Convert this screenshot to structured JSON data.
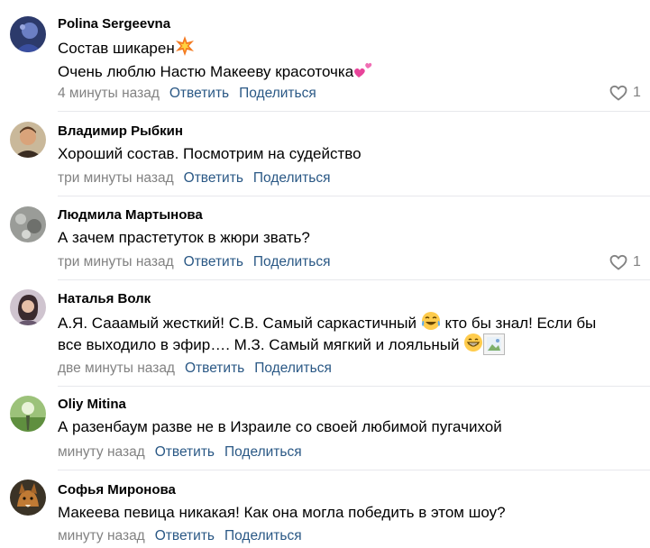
{
  "comments": [
    {
      "author": "Polina Sergeevna",
      "lines": [
        "Состав шикарен",
        "Очень люблю Настю Макееву красоточка"
      ],
      "time": "4 минуты назад",
      "reply": "Ответить",
      "share": "Поделиться",
      "likes": "1"
    },
    {
      "author": "Владимир Рыбкин",
      "lines": [
        "Хороший состав. Посмотрим на судейство"
      ],
      "time": "три минуты назад",
      "reply": "Ответить",
      "share": "Поделиться"
    },
    {
      "author": "Людмила Мартынова",
      "lines": [
        "А зачем прастетуток в жюри звать?"
      ],
      "time": "три минуты назад",
      "reply": "Ответить",
      "share": "Поделиться",
      "likes": "1"
    },
    {
      "author": "Наталья Волк",
      "lines": [
        "А.Я. Сааамый жесткий! С.В. Самый саркастичный",
        "кто бы знал! Если бы",
        "все выходило в эфир…. М.З. Самый мягкий и лояльный"
      ],
      "time": "две минуты назад",
      "reply": "Ответить",
      "share": "Поделиться"
    },
    {
      "author": "Oliy Mitina",
      "lines": [
        "А разенбаум разве не в Израиле со своей любимой пугачихой"
      ],
      "time": "минуту назад",
      "reply": "Ответить",
      "share": "Поделиться"
    },
    {
      "author": "Софья Миронова",
      "lines": [
        "Макеева певица никакая! Как она могла победить в этом шоу?"
      ],
      "time": "минуту назад",
      "reply": "Ответить",
      "share": "Поделиться"
    }
  ],
  "colors": {
    "link": "#2a5885",
    "meta": "#828282",
    "divider": "#e7e8ec"
  },
  "icons": {
    "like": "heart-outline-icon",
    "emoji_1": "collision-emoji",
    "emoji_2": "pink-hearts-emoji",
    "emoji_3": "tears-of-joy-emoji",
    "emoji_4": "grinning-emoji"
  }
}
